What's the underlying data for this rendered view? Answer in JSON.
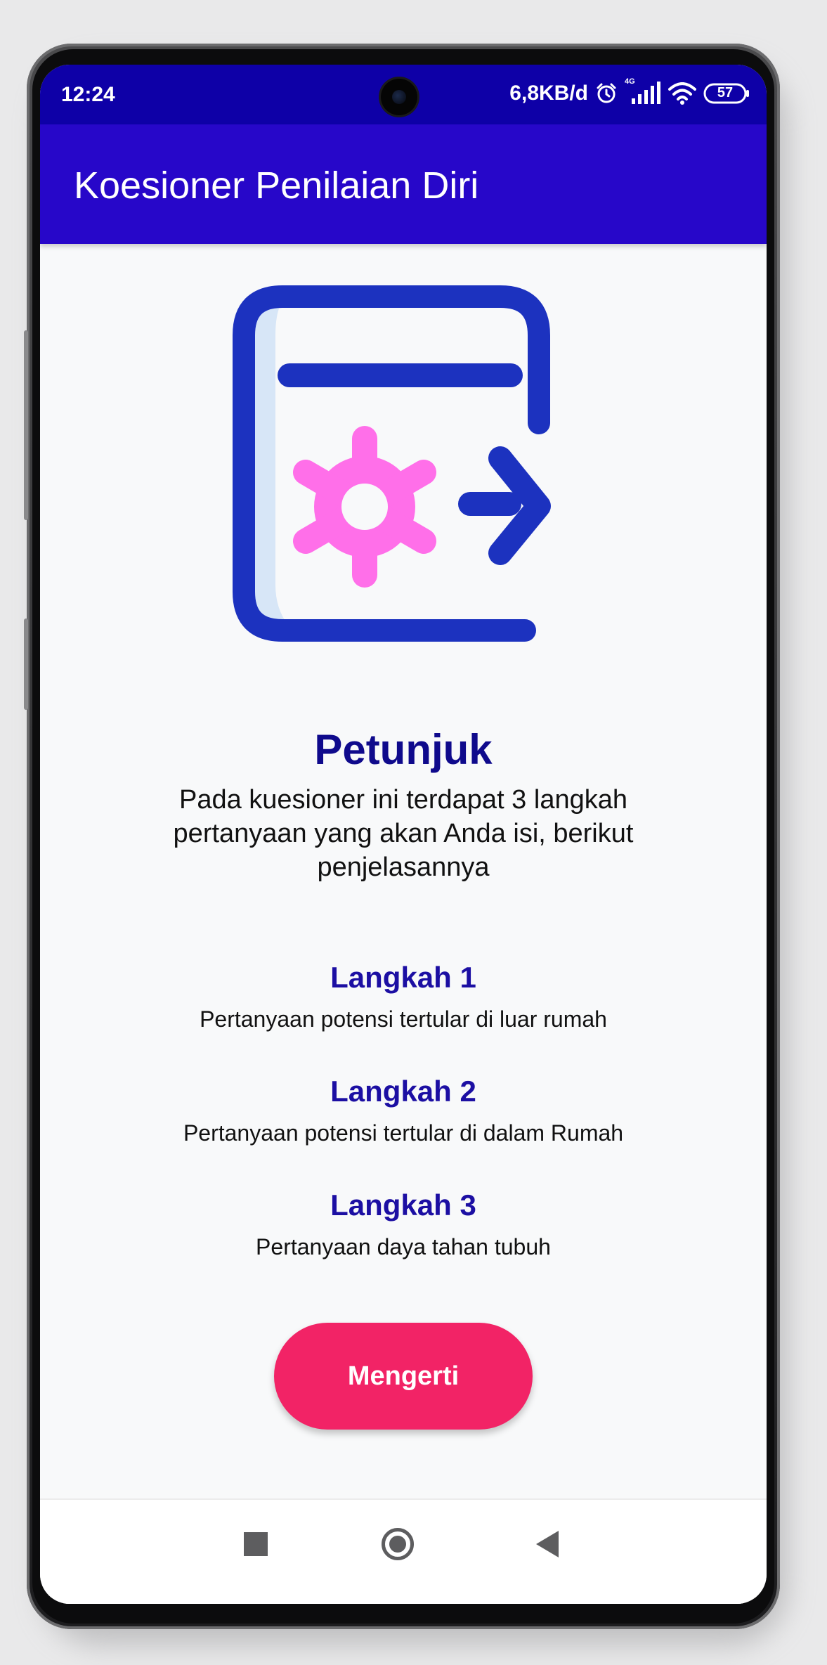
{
  "status_bar": {
    "time": "12:24",
    "network_speed": "6,8KB/d",
    "network_type": "4G",
    "battery": "57",
    "icons": [
      "alarm-icon",
      "signal-icon",
      "wifi-icon",
      "battery-icon"
    ]
  },
  "app_bar": {
    "title": "Koesioner Penilaian Diri"
  },
  "illustration": {
    "icon": "settings-exit-icon",
    "colors": {
      "frame": "#1c32bf",
      "shade": "#d7e6f7",
      "gear": "#ff6fe9"
    }
  },
  "content": {
    "heading": "Petunjuk",
    "intro": "Pada kuesioner ini terdapat 3 langkah pertanyaan yang akan Anda isi, berikut penjelasannya",
    "steps": [
      {
        "title": "Langkah 1",
        "description": "Pertanyaan potensi tertular di luar rumah"
      },
      {
        "title": "Langkah 2",
        "description": "Pertanyaan potensi tertular di dalam Rumah"
      },
      {
        "title": "Langkah 3",
        "description": "Pertanyaan daya tahan tubuh"
      }
    ]
  },
  "button": {
    "label": "Mengerti",
    "color": "#f22366"
  },
  "nav_bar": {
    "icons": [
      "recents-square-icon",
      "home-circle-icon",
      "back-triangle-icon"
    ]
  },
  "colors": {
    "status_bar": "#0e00a7",
    "app_bar": "#2707c9",
    "heading": "#0f0a8c",
    "step_title": "#1c0fa3"
  }
}
